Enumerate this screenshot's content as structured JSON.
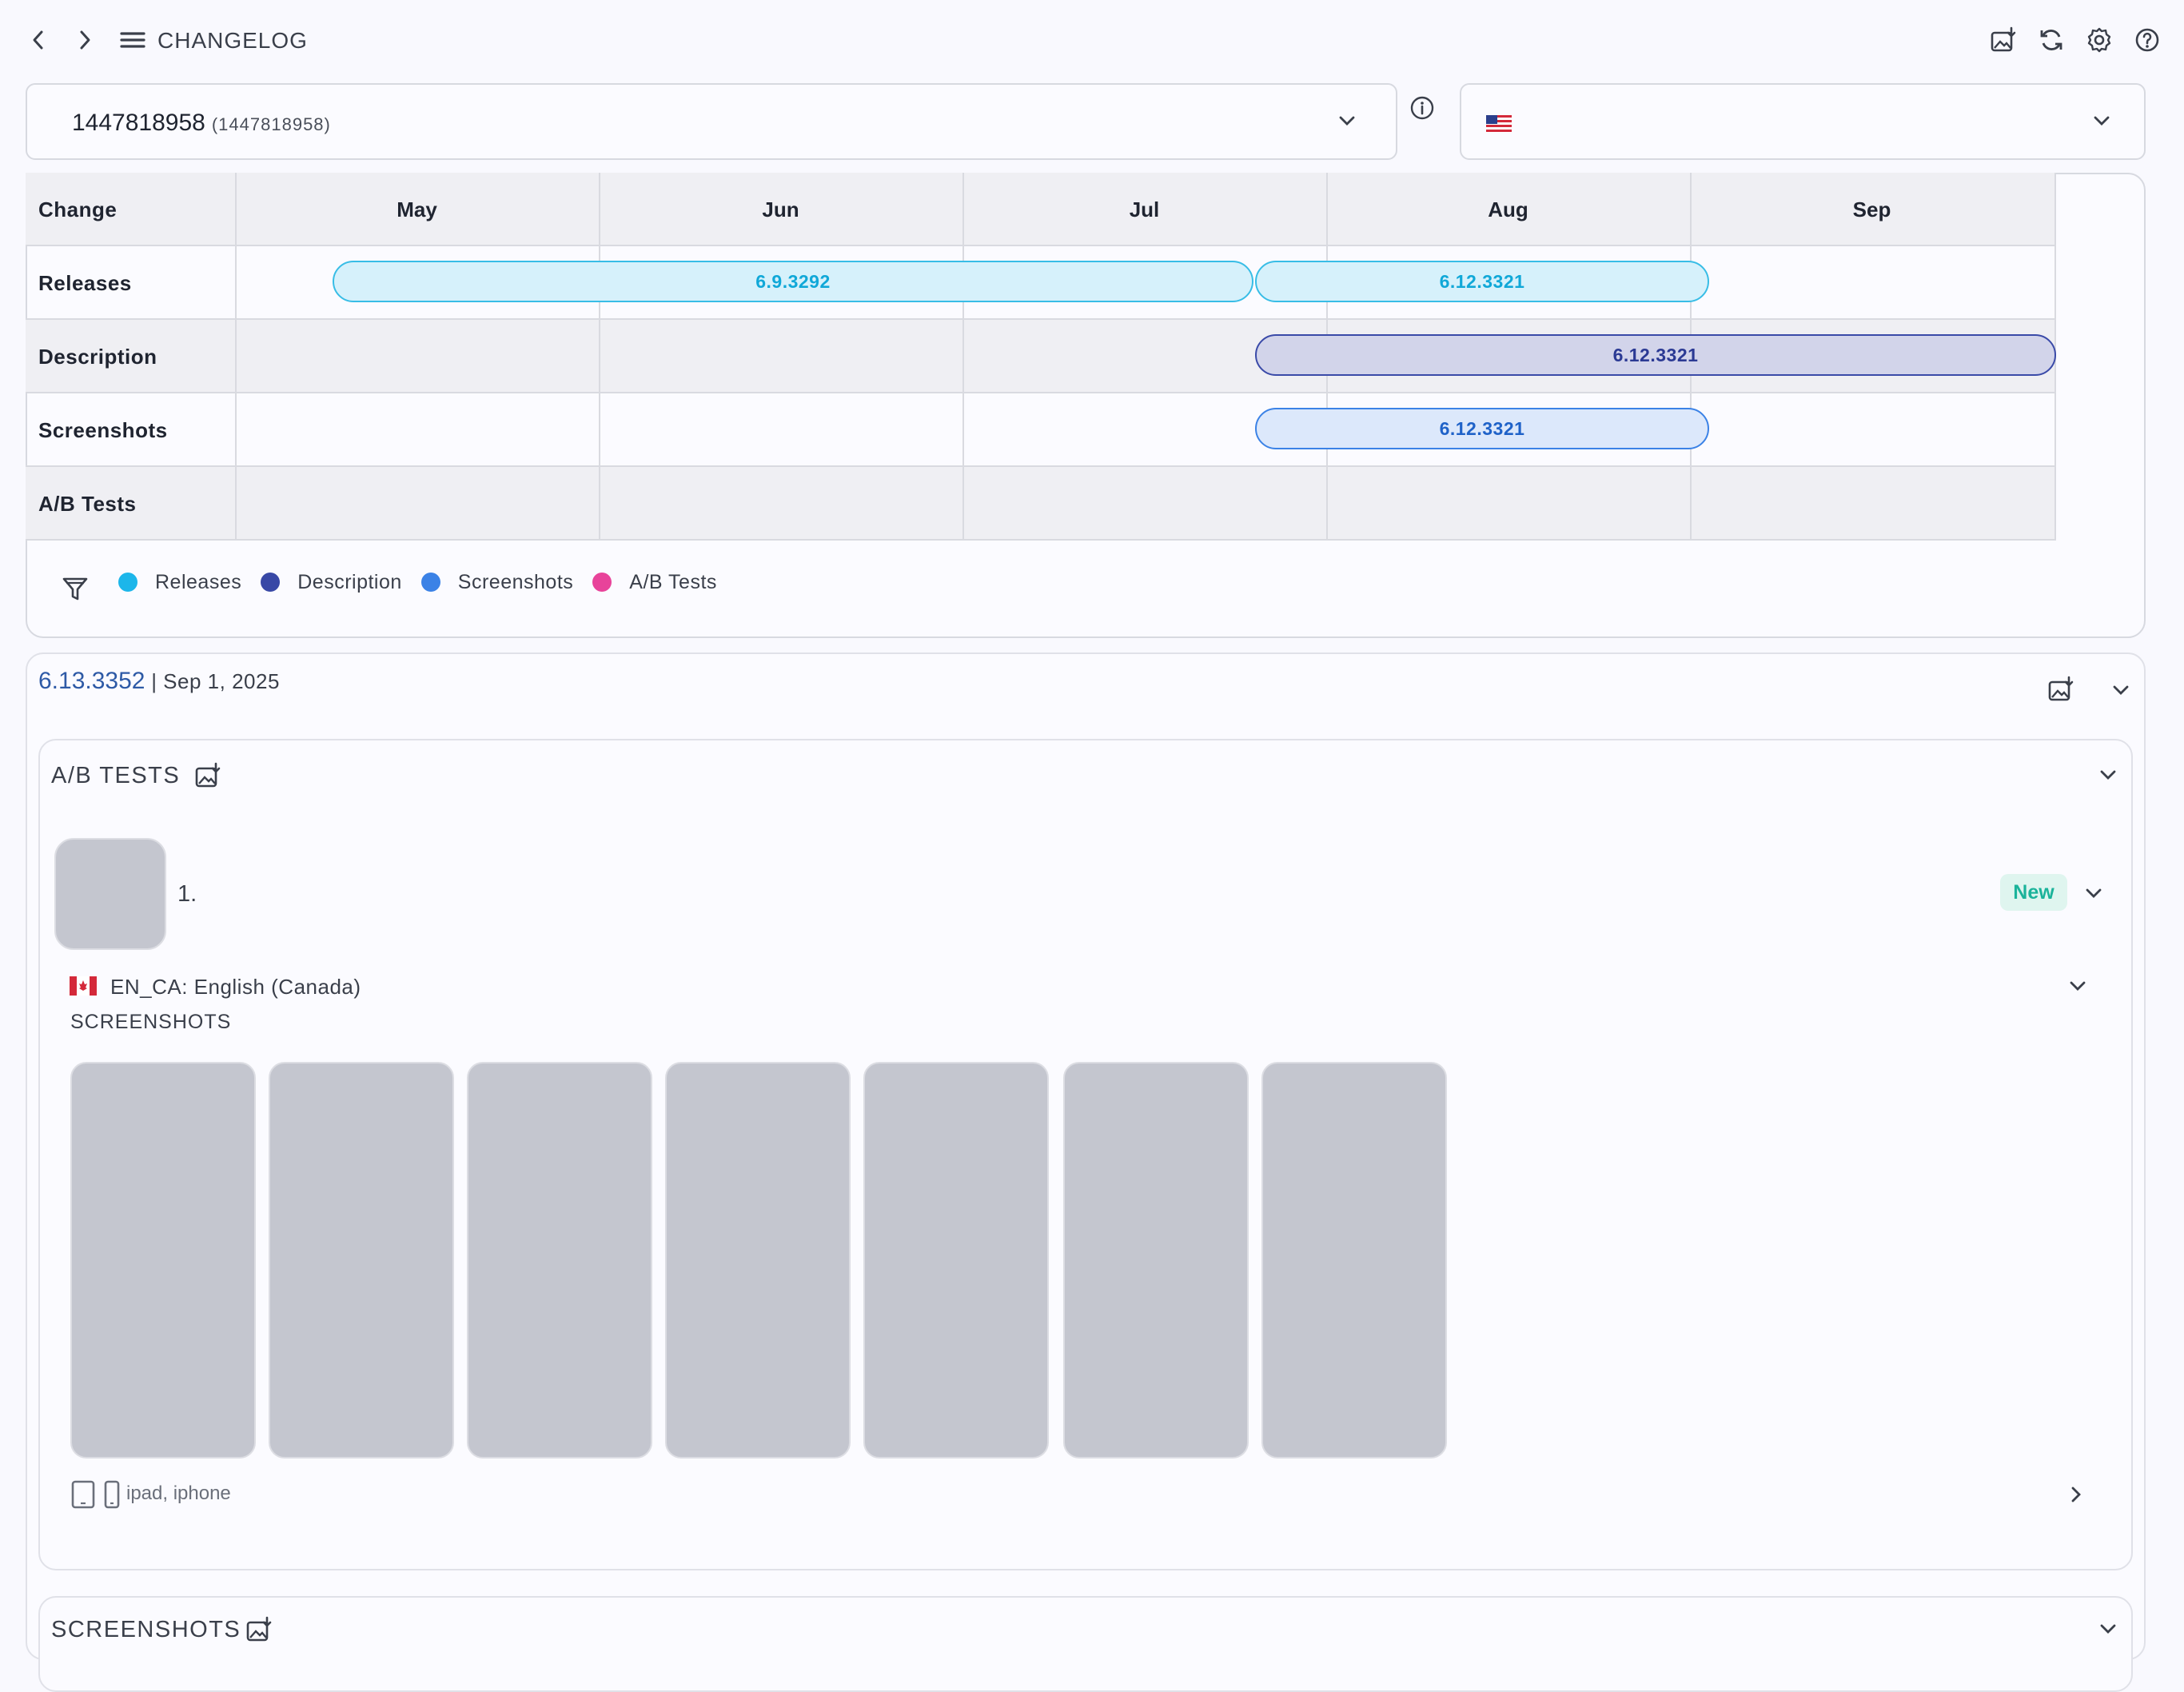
{
  "header": {
    "title": "CHANGELOG",
    "back_icon": "chevron-left-icon",
    "forward_icon": "chevron-right-icon",
    "menu_icon": "menu-icon",
    "actions": [
      "image-download-icon",
      "refresh-icon",
      "settings-icon",
      "help-icon"
    ]
  },
  "app_select": {
    "value": "1447818958",
    "sub_value": "(1447818958)",
    "info_icon": "info-icon"
  },
  "country_select": {
    "flag": "us-flag-icon"
  },
  "timeline": {
    "header_label": "Change",
    "months": [
      "May",
      "Jun",
      "Jul",
      "Aug",
      "Sep"
    ],
    "rows": [
      "Releases",
      "Description",
      "Screenshots",
      "A/B Tests"
    ],
    "bars": [
      {
        "row": "Releases",
        "label": "6.9.3292",
        "kind": "rel"
      },
      {
        "row": "Releases",
        "label": "6.12.3321",
        "kind": "rel"
      },
      {
        "row": "Description",
        "label": "6.12.3321",
        "kind": "desc"
      },
      {
        "row": "Screenshots",
        "label": "6.12.3321",
        "kind": "shot"
      }
    ],
    "legend": [
      {
        "label": "Releases",
        "color": "#1cb6ea"
      },
      {
        "label": "Description",
        "color": "#3848a6"
      },
      {
        "label": "Screenshots",
        "color": "#3b82e6"
      },
      {
        "label": "A/B Tests",
        "color": "#e8439a"
      }
    ]
  },
  "version_card": {
    "version": "6.13.3352",
    "separator": " | ",
    "date": "Sep 1, 2025",
    "ab_tests": {
      "title": "A/B TESTS",
      "item_number": "1.",
      "badge": "New",
      "locale_flag": "ca-flag-icon",
      "locale": "EN_CA: English (Canada)",
      "screenshots_label": "SCREENSHOTS",
      "devices": "ipad, iphone"
    },
    "next_section_title": "SCREENSHOTS"
  }
}
